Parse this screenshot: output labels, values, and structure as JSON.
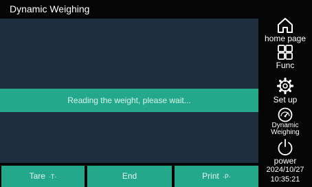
{
  "window": {
    "title": "Dynamic Weighing"
  },
  "status": {
    "message": "Reading the weight, please wait..."
  },
  "buttons": {
    "tare": {
      "label": "Tare",
      "key": "·T·"
    },
    "end": {
      "label": "End"
    },
    "print": {
      "label": "Print",
      "key": "·P·"
    }
  },
  "sidebar": {
    "items": [
      {
        "label": "home page",
        "icon": "home-icon"
      },
      {
        "label": "Func",
        "icon": "grid-icon"
      },
      {
        "label": "Set up",
        "icon": "gear-icon"
      },
      {
        "label": "Dynamic",
        "label2": "Weighing",
        "icon": "gauge-icon"
      },
      {
        "label": "power",
        "icon": "power-icon"
      }
    ]
  },
  "datetime": {
    "date": "2024/10/27",
    "time": "10:35:21"
  },
  "colors": {
    "background": "#050505",
    "panel": "#1f2e3e",
    "accent": "#23a88b",
    "text": "#ffffff"
  }
}
